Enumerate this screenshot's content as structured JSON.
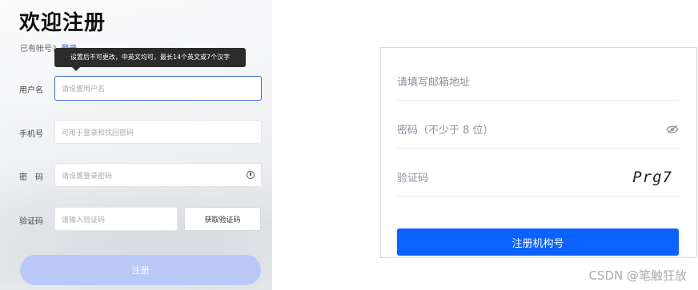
{
  "left_form": {
    "title": "欢迎注册",
    "has_account_text": "已有帐号?",
    "login_link": "登录",
    "tooltip": "设置后不可更改，中英文均可，最长14个英文或7个汉字",
    "username": {
      "label": "用户名",
      "placeholder": "请设置用户名"
    },
    "phone": {
      "label": "手机号",
      "placeholder": "可用于登录和找回密码"
    },
    "password": {
      "label": "密　码",
      "placeholder": "请设置登录密码"
    },
    "code": {
      "label": "验证码",
      "placeholder": "请输入验证码",
      "button": "获取验证码"
    },
    "submit": "注册"
  },
  "right_form": {
    "email_placeholder": "请填写邮箱地址",
    "password_placeholder": "密码（不少于 8 位）",
    "captcha_label": "验证码",
    "captcha_text": "Prg7",
    "register_button": "注册机构号"
  },
  "watermark": "CSDN @笔触狂放",
  "colors": {
    "primary_blue": "#0b62ff",
    "disabled_submit": "#b9c8f7",
    "link": "#2c5fd6"
  }
}
